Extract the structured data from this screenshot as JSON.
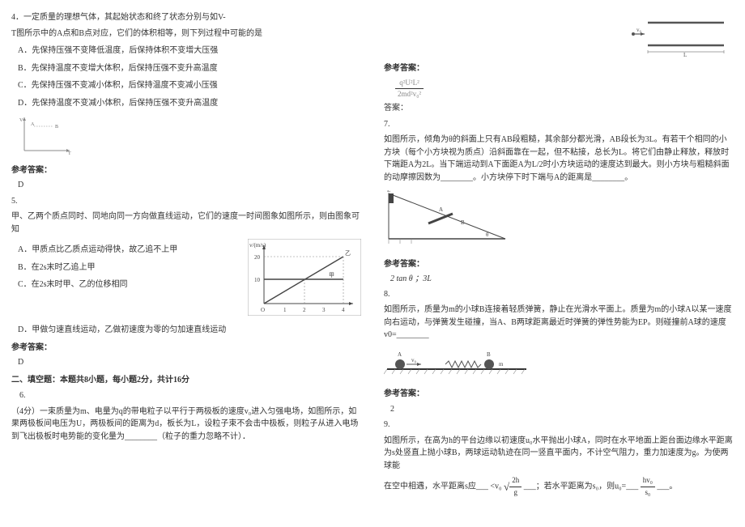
{
  "q4": {
    "stem1": "4．一定质量的理想气体，其起始状态和终了状态分别与如V-",
    "stem2": "T图所示中的A点和B点对应，它们的体积相等，则下列过程中可能的是",
    "A": "A．先保持压强不变降低温度，后保持体积不变增大压强",
    "B": "B．先保持温度不变增大体积，后保持压强不变升高温度",
    "C": "C．先保持压强不变减小体积，后保持温度不变减小压强",
    "D": "D．先保持温度不变减小体积，后保持压强不变升高温度",
    "ans_label": "参考答案：",
    "ans": "D"
  },
  "q5": {
    "num": "5.",
    "stem": "甲、乙两个质点同时、同地向同一方向做直线运动，它们的速度一时间图象如图所示，则由图象可知",
    "A": "A．甲质点比乙质点运动得快，故乙追不上甲",
    "B": "B．在2s末时乙追上甲",
    "C": "C．在2s末时甲、乙的位移相同",
    "D": "D．甲做匀速直线运动，乙做初速度为零的匀加速直线运动",
    "ans_label": "参考答案：",
    "ans": "D"
  },
  "sec2": {
    "head": "二、填空题：本题共8小题，每小题2分，共计16分",
    "q6": {
      "num": "6.",
      "stem": "（4分）一束质量为m、电量为q的带电粒子以平行于两极板的速度v₀进入匀强电场，如图所示，如果两极板间电压为U，两极板间的距离为d，板长为L，设粒子束不会击中极板，则粒子从进入电场到飞出极板时电势能的变化量为________（粒子的重力忽略不计）．"
    }
  },
  "q6_fig": {
    "L": "L",
    "v0": "v₀"
  },
  "q6_ans_label": "参考答案：",
  "q6_ans_prefix": "答案：",
  "q6_frac_num": "q²U²L²",
  "q6_frac_den": "2md²v₀²",
  "q7": {
    "num": "7.",
    "stem": "如图所示，倾角为θ的斜面上只有AB段粗糙，其余部分都光滑，AB段长为3L。有若干个相同的小方块（每个小方块视为质点）沿斜面靠在一起，但不粘接，总长为L。将它们由静止释放，释放时下端距A为2L。当下端运动到A下面距A为L/2时小方块运动的速度达到最大。则小方块与粗糙斜面的动摩擦因数为________。小方块停下时下端与A的距离是________。",
    "ans_label": "参考答案：",
    "ans": "2 tan θ ；3L"
  },
  "q8": {
    "stem": "如图所示，质量为m的小球B连接着轻质弹簧，静止在光滑水平面上。质量为m的小球A以某一速度向右运动，与弹簧发生碰撞，当A、B两球距离最近时弹簧的弹性势能为EP。则碰撞前A球的速度v0=________",
    "ans_label": "参考答案：",
    "ans": "2"
  },
  "q9": {
    "num": "9.",
    "stem": "如图所示，在高为h的平台边缘以初速度u₀水平抛出小球A，同时在水平地面上距台面边缘水平距离为s处竖直上抛小球B，两球运动轨迹在同一竖直平面内，不计空气阻力，重力加速度为g。为使两球能",
    "blank1": "在空中相遇，水平距离s应___",
    "cond1_pre": "<v₀",
    "frac1_num": "2h",
    "frac1_den": "g",
    "blank2": "___；若水平距离为s₀，则u₀=___",
    "frac2_num": "hv₀",
    "frac2_den": "s₀",
    "blank3": "___。"
  },
  "chart_data": [
    {
      "type": "line",
      "name": "V-T graph (Q4)",
      "xlabel": "T",
      "ylabel": "V",
      "points": [
        "A",
        "B"
      ],
      "note": "A upper-left, B to the right; same volume implied"
    },
    {
      "type": "line",
      "name": "v-t graph (Q5)",
      "xlabel": "t/s",
      "ylabel": "v/(m/s)",
      "xlim": [
        0,
        4
      ],
      "ylim": [
        0,
        20
      ],
      "xticks": [
        1,
        2,
        3,
        4
      ],
      "yticks": [
        10,
        20
      ],
      "series": [
        {
          "name": "甲",
          "type": "horizontal",
          "y": 10
        },
        {
          "name": "乙",
          "type": "linear",
          "points": [
            [
              0,
              0
            ],
            [
              4,
              20
            ]
          ]
        }
      ]
    }
  ]
}
